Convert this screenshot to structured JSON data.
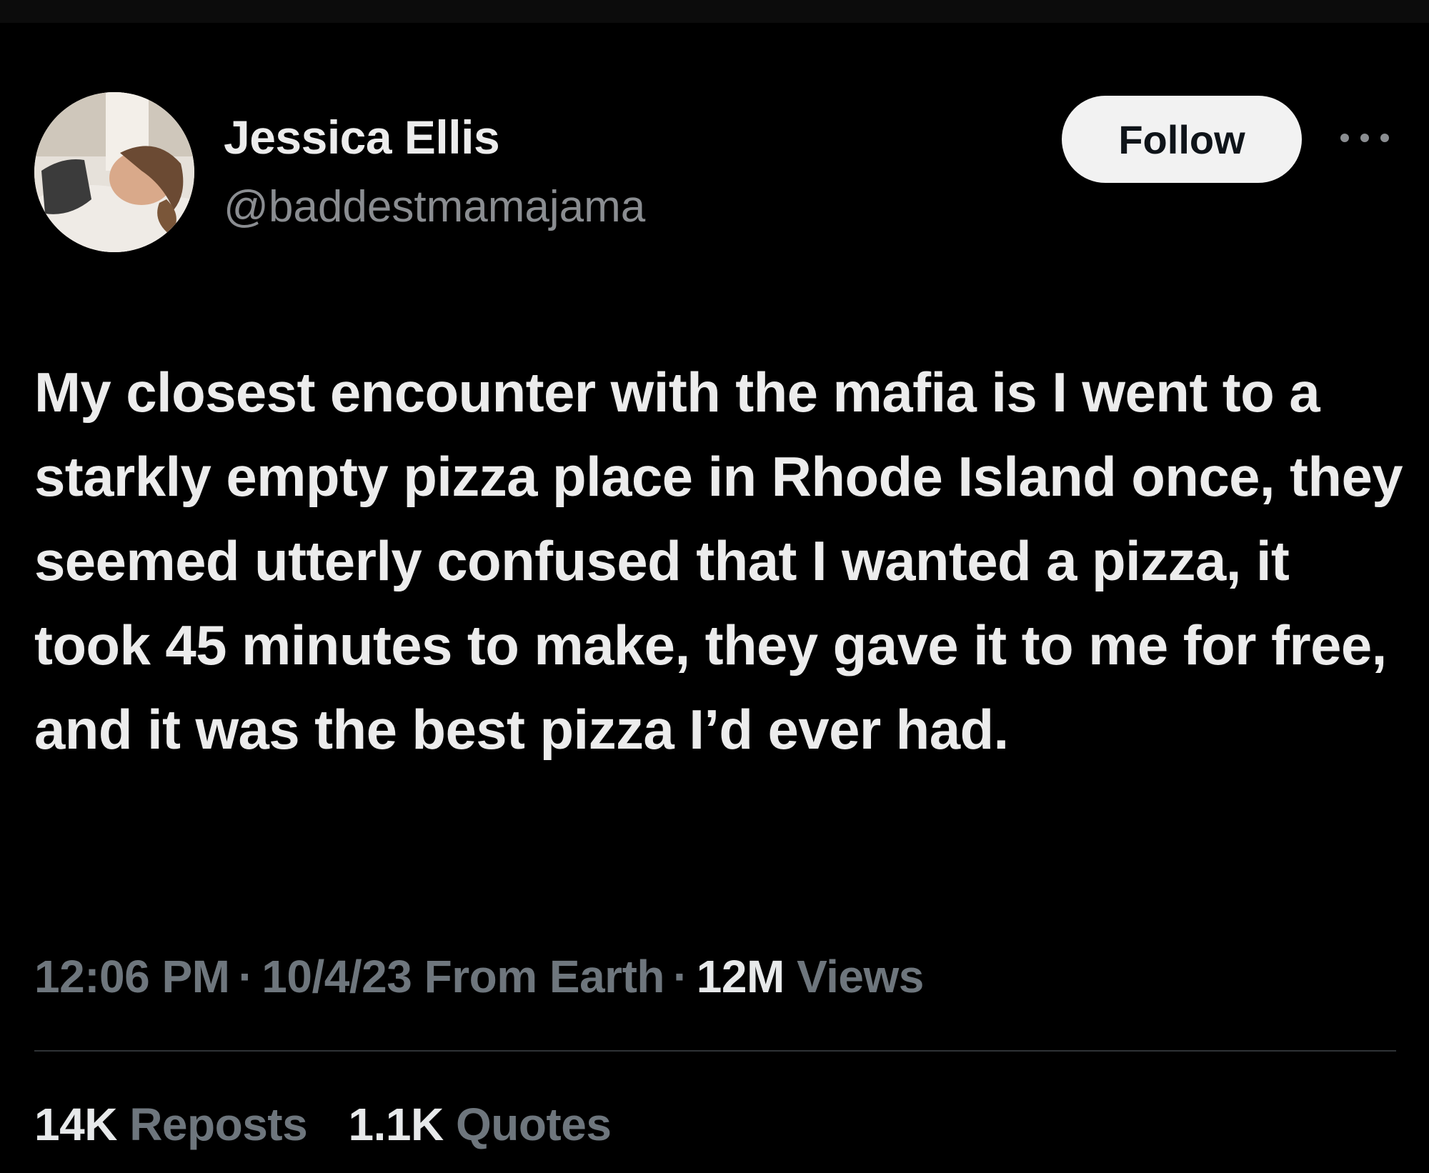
{
  "author": {
    "display_name": "Jessica Ellis",
    "handle": "@baddestmamajama"
  },
  "follow_button": {
    "label": "Follow"
  },
  "menu": {
    "icon": "more-horizontal-icon"
  },
  "tweet": {
    "text": "My closest encounter with the mafia is I went to a starkly empty pizza place in Rhode Island once, they seemed utterly confused that I wanted a pizza, it took 45 minutes to make, they gave it to me for free, and it was the best pizza I’d ever had."
  },
  "meta": {
    "time": "12:06 PM",
    "separator": "·",
    "date": "10/4/23",
    "source": "From Earth",
    "views_count": "12M",
    "views_label": "Views"
  },
  "stats": {
    "reposts_count": "14K",
    "reposts_label": "Reposts",
    "quotes_count": "1.1K",
    "quotes_label": "Quotes"
  },
  "colors": {
    "background": "#000000",
    "text_primary": "#e7e9ea",
    "text_secondary": "#6e767d",
    "follow_button_bg": "#f2f2f2",
    "divider": "#2f3336"
  }
}
